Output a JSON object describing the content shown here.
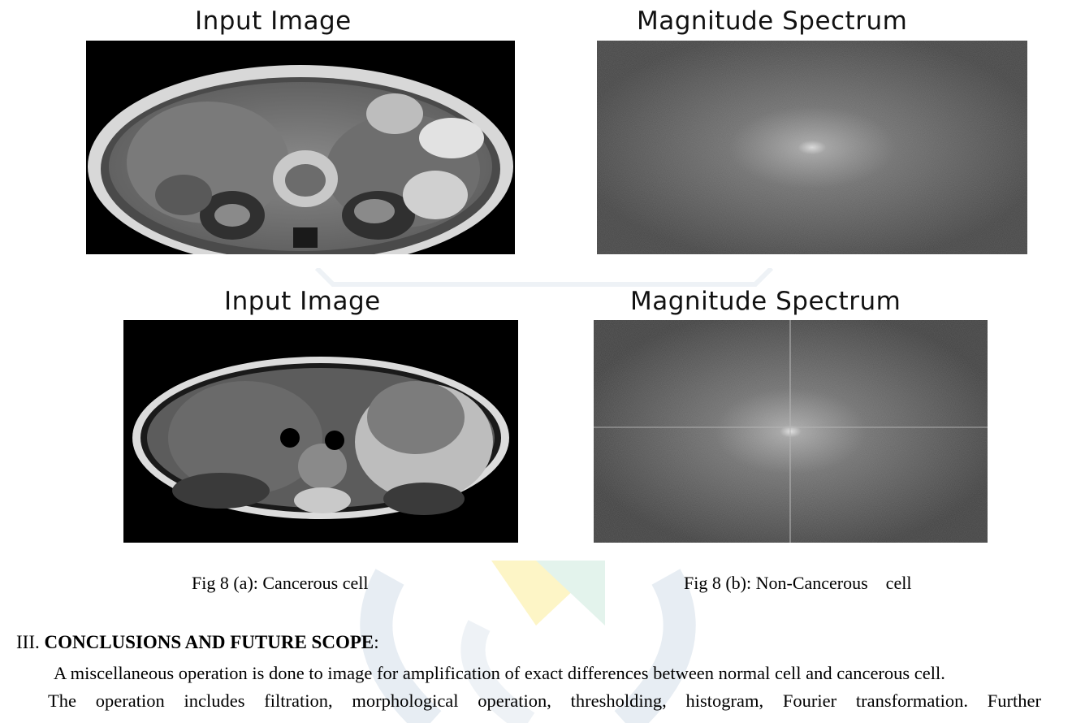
{
  "figures": {
    "top_left_title": "Input Image",
    "top_right_title": "Magnitude Spectrum",
    "bottom_left_title": "Input Image",
    "bottom_right_title": "Magnitude Spectrum"
  },
  "captions": {
    "a": "Fig 8 (a): Cancerous cell",
    "b": "Fig 8 (b): Non-Cancerous    cell"
  },
  "section": {
    "number": "III.",
    "title": "CONCLUSIONS AND FUTURE SCOPE",
    "suffix": ":"
  },
  "body": {
    "line1": "A miscellaneous operation is done to image for amplification of exact differences between normal cell and cancerous cell.",
    "line2": "The operation includes filtration, morphological operation, thresholding, histogram, Fourier transformation. Further"
  }
}
